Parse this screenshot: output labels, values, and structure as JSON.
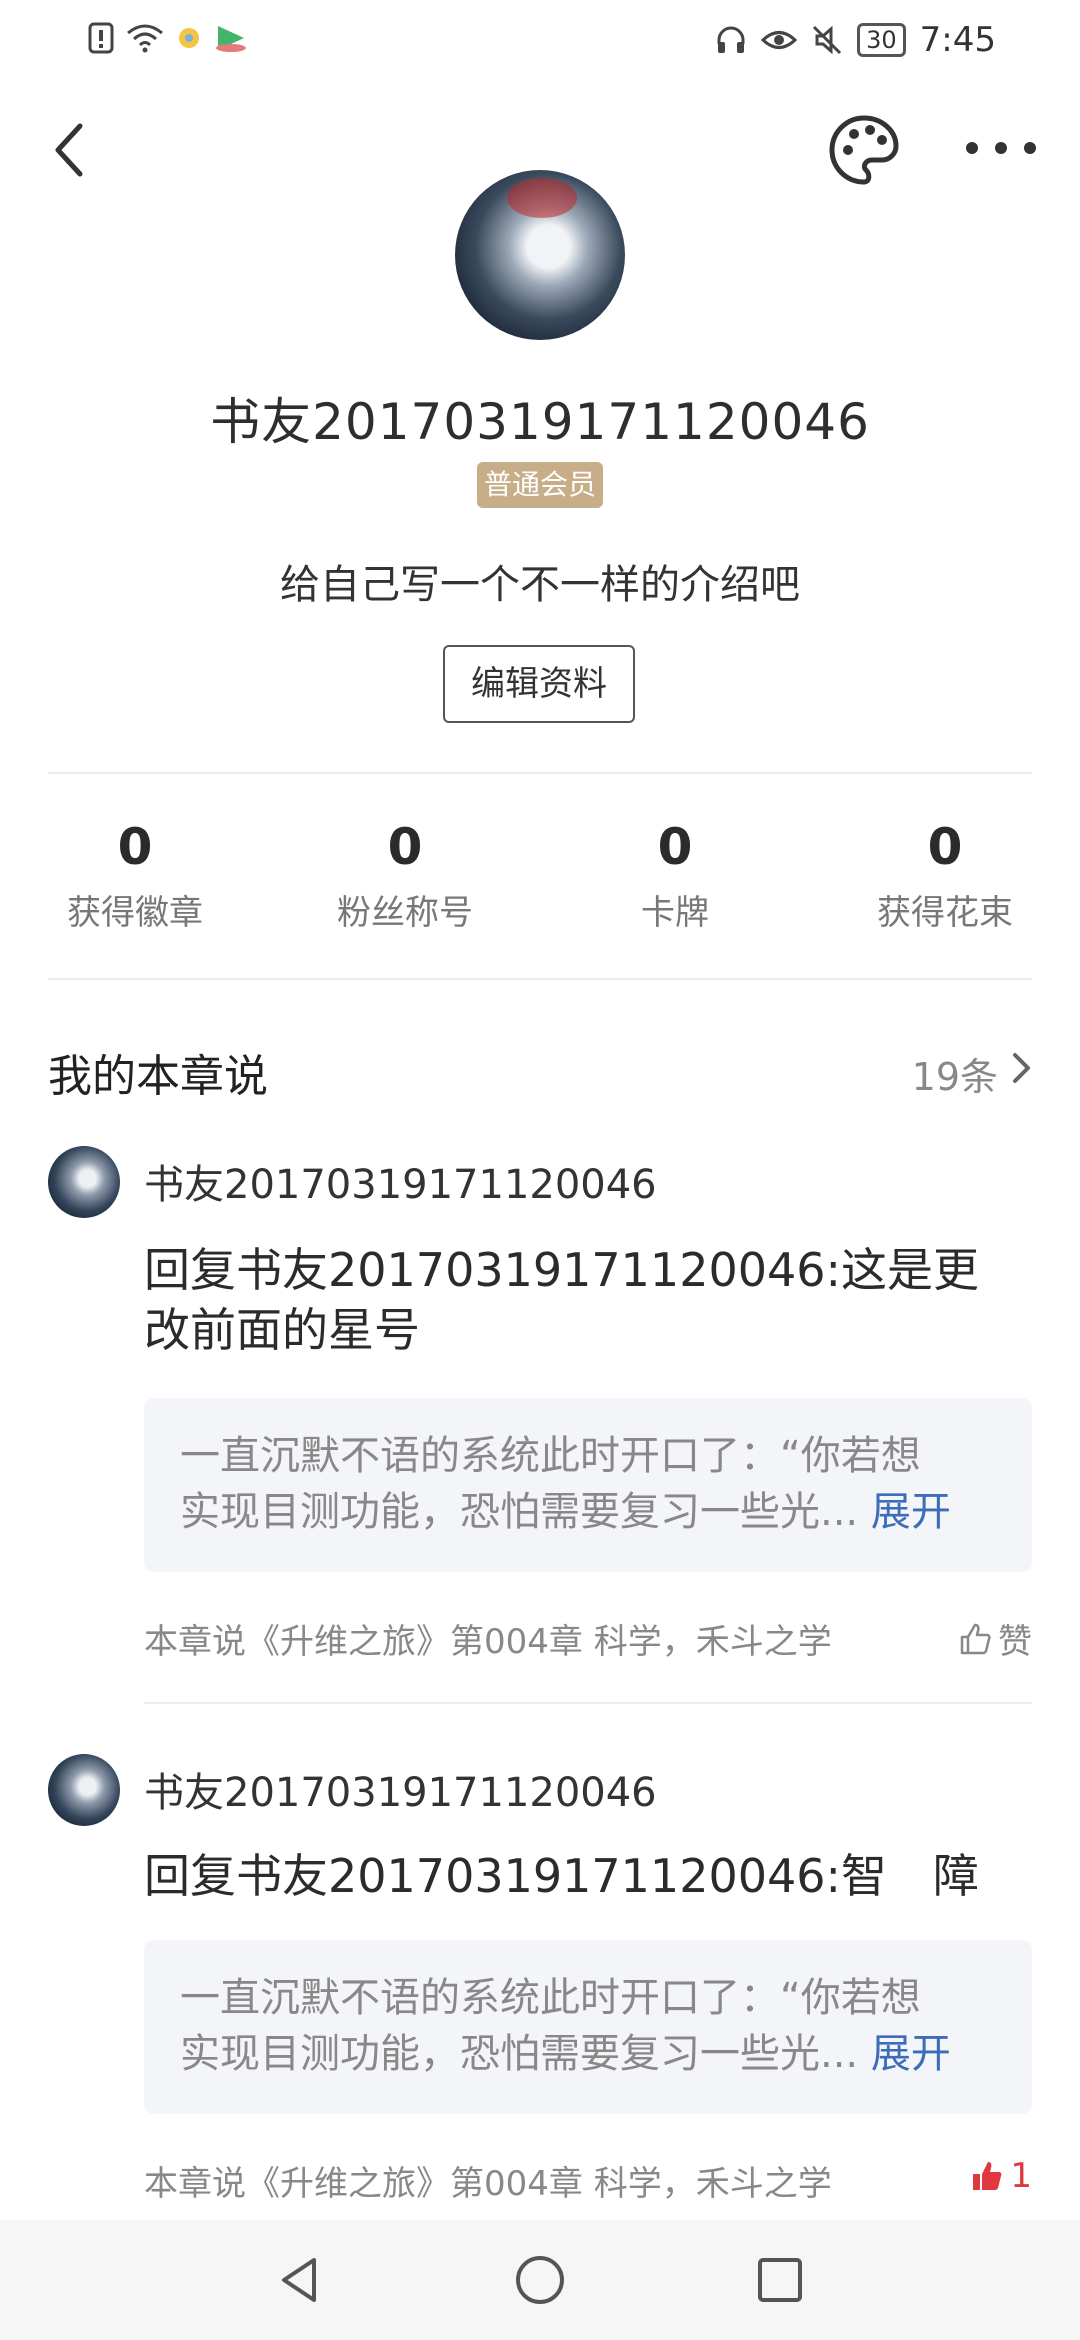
{
  "status_bar": {
    "time": "7:45",
    "battery": "30",
    "left_icons": [
      "alert-icon",
      "wifi-icon",
      "app-icon",
      "play-icon"
    ],
    "right_icons": [
      "headset-icon",
      "eye-icon",
      "mute-icon"
    ]
  },
  "profile": {
    "username": "书友20170319171120046",
    "member_badge": "普通会员",
    "bio": "给自己写一个不一样的介绍吧",
    "edit_button": "编辑资料"
  },
  "stats": [
    {
      "value": "0",
      "label": "获得徽章"
    },
    {
      "value": "0",
      "label": "粉丝称号"
    },
    {
      "value": "0",
      "label": "卡牌"
    },
    {
      "value": "0",
      "label": "获得花束"
    }
  ],
  "section": {
    "title": "我的本章说",
    "count": "19条"
  },
  "comments": [
    {
      "user": "书友20170319171120046",
      "text": "回复书友20170319171120046:这是更改前面的星号",
      "quote_line1": "一直沉默不语的系统此时开口了：“你若想",
      "quote_line2": "实现目测功能，恐怕需要复习一些光...",
      "expand": "展开",
      "source": "本章说《升维之旅》第004章 科学，禾斗之学",
      "like": "赞",
      "like_color": "#888888"
    },
    {
      "user": "书友20170319171120046",
      "text": "回复书友20170319171120046:智　障",
      "quote_line1": "一直沉默不语的系统此时开口了：“你若想",
      "quote_line2": "实现目测功能，恐怕需要复习一些光...",
      "expand": "展开",
      "source": "本章说《升维之旅》第004章 科学，禾斗之学",
      "like": "1",
      "like_color": "#e0383e"
    }
  ],
  "colors": {
    "badge": "#c8ad89",
    "link": "#3d6cb8",
    "liked": "#e0383e"
  }
}
